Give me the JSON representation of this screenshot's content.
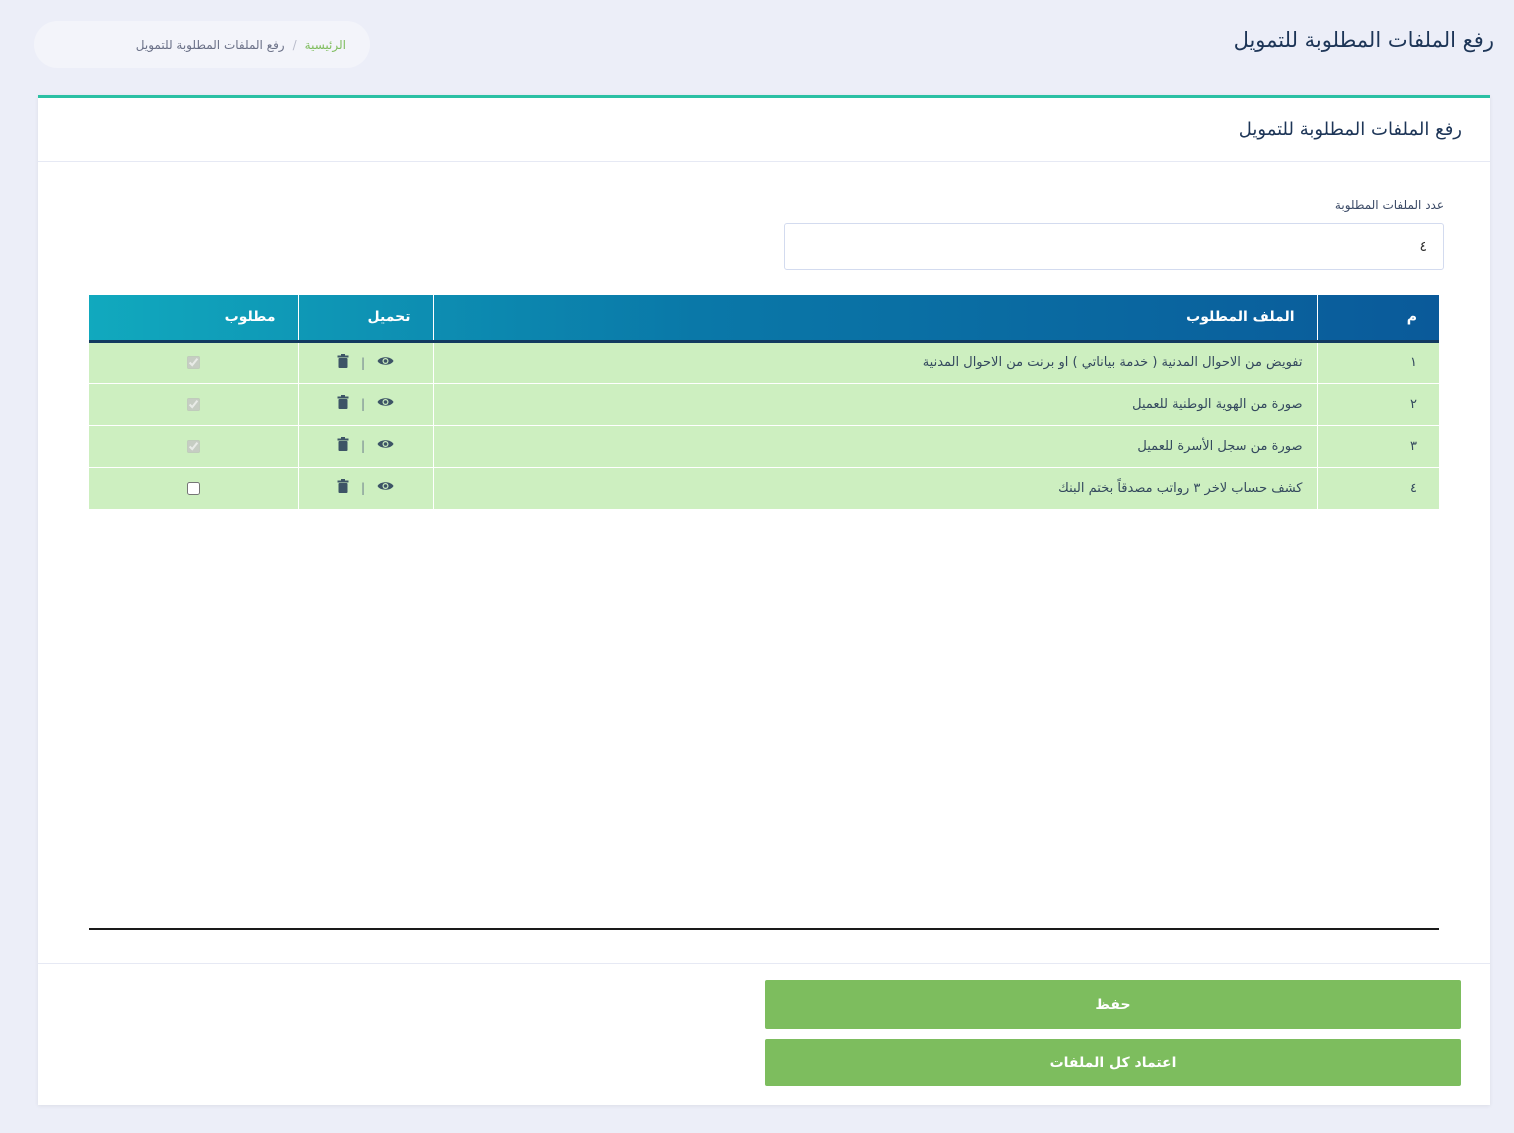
{
  "header": {
    "title": "رفع الملفات المطلوبة للتمويل"
  },
  "breadcrumb": {
    "home": "الرئيسية",
    "separator": "/",
    "current": "رفع الملفات المطلوبة للتمويل"
  },
  "card": {
    "title": "رفع الملفات المطلوبة للتمويل",
    "count_label": "عدد الملفات المطلوبة",
    "count_value": "٤"
  },
  "table": {
    "columns": [
      "م",
      "الملف المطلوب",
      "تحميل",
      "مطلوب"
    ],
    "rows": [
      {
        "num": "١",
        "file": "تفويض من الاحوال المدنية ( خدمة بياناتي ) او برنت من الاحوال المدنية",
        "required": true
      },
      {
        "num": "٢",
        "file": "صورة من الهوية الوطنية للعميل",
        "required": true
      },
      {
        "num": "٣",
        "file": "صورة من سجل الأسرة للعميل",
        "required": true
      },
      {
        "num": "٤",
        "file": "كشف حساب لاخر ٣ رواتب مصدقاً بختم البنك",
        "required": false
      }
    ],
    "action_separator": "|",
    "icons": {
      "view": "eye-icon",
      "delete": "trash-icon"
    }
  },
  "buttons": {
    "save": "حفظ",
    "approve_all": "اعتماد كل الملفات"
  },
  "colors": {
    "accent_green": "#7dbd5e",
    "row_green": "#cdefc0",
    "header_blue": "#0a78a8",
    "top_border": "#2bc0a4"
  }
}
